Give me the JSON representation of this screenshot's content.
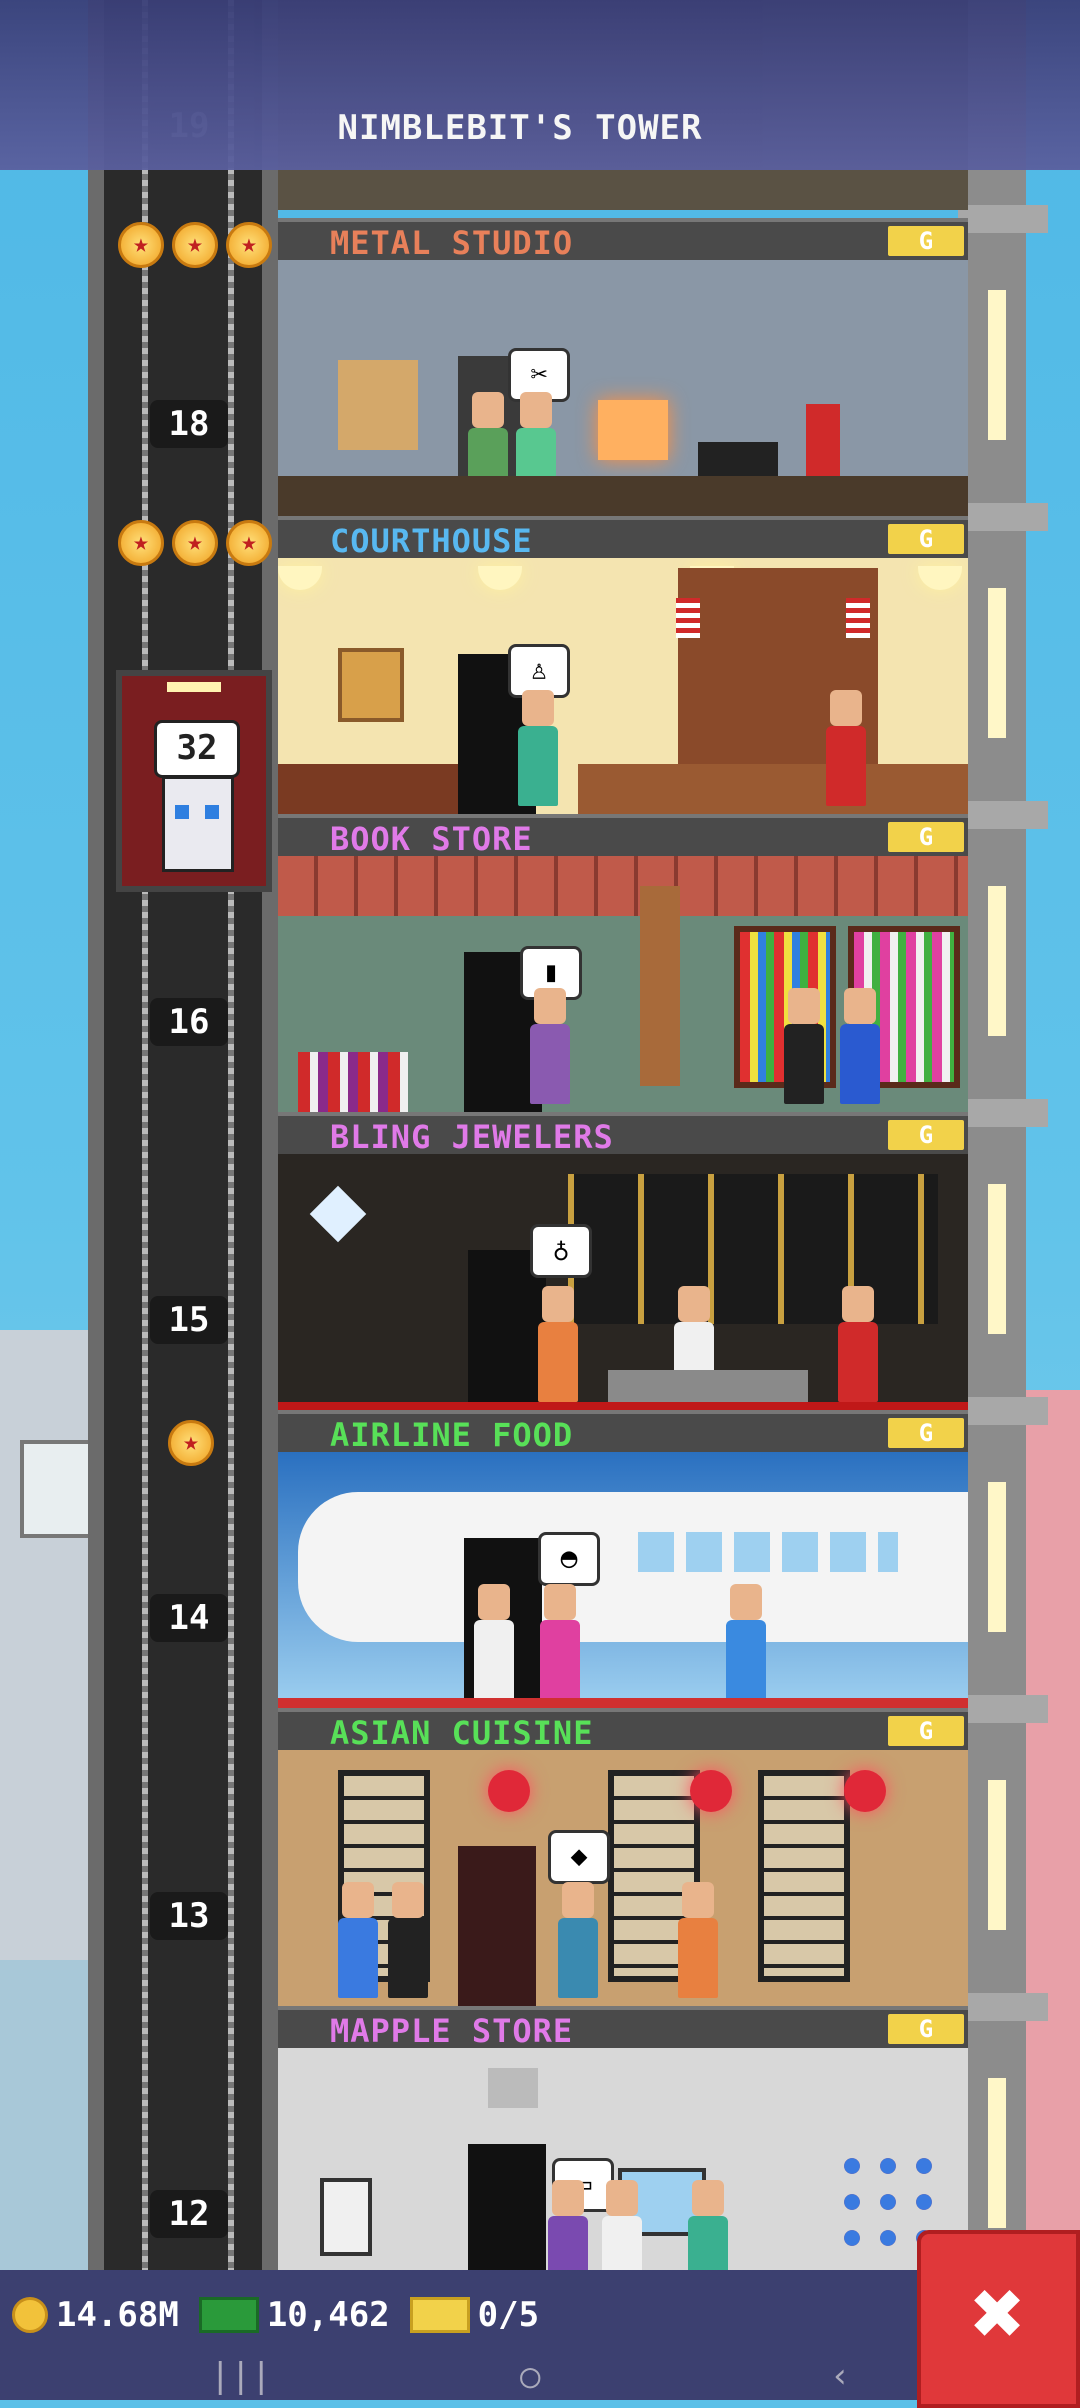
{
  "header": {
    "title": "NIMBLEBIT'S TOWER"
  },
  "elevator": {
    "count": "32"
  },
  "shaft_numbers": {
    "f19": "19",
    "f18": "18",
    "f16": "16",
    "f15": "15",
    "f14": "14",
    "f13": "13",
    "f12": "12"
  },
  "floors": [
    {
      "name": "METAL STUDIO",
      "color": "#e8805a",
      "rating": 3,
      "bubble": "✂"
    },
    {
      "name": "COURTHOUSE",
      "color": "#58b8f0",
      "rating": 3,
      "bubble": "♙"
    },
    {
      "name": "BOOK STORE",
      "color": "#e07ae8",
      "rating": 0,
      "bubble": "▮"
    },
    {
      "name": "BLING JEWELERS",
      "color": "#e07ae8",
      "rating": 0,
      "bubble": "♁"
    },
    {
      "name": "AIRLINE FOOD",
      "color": "#58e058",
      "rating": 1,
      "bubble": "◓"
    },
    {
      "name": "ASIAN CUISINE",
      "color": "#58e058",
      "rating": 0,
      "bubble": "◆"
    },
    {
      "name": "MAPPLE STORE",
      "color": "#e07ae8",
      "rating": 0,
      "bubble": "▭"
    }
  ],
  "floor_badge": "G",
  "hud": {
    "coins": "14.68M",
    "bux": "10,462",
    "tickets": "0/5"
  },
  "icons": {
    "coin": "coin-icon",
    "bux": "bux-icon",
    "ticket": "ticket-icon",
    "close": "close-icon",
    "star": "star-icon"
  },
  "close_label": "✖",
  "nav": {
    "home": "○",
    "back": "‹",
    "recents": "|||"
  }
}
